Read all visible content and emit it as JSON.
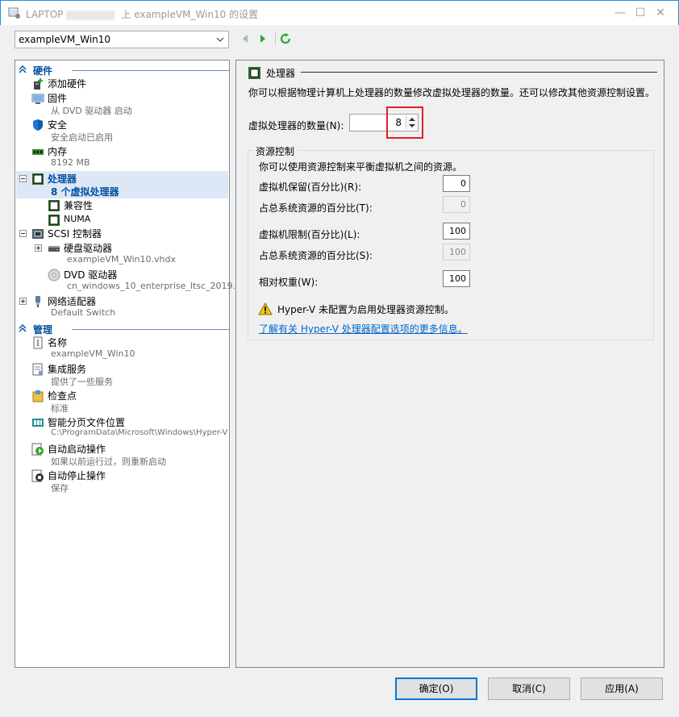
{
  "window": {
    "title_prefix": "LAPTOP",
    "title_suffix": "上 exampleVM_Win10 的设置",
    "minimize": "—",
    "maximize": "☐",
    "close": "✕"
  },
  "vm_selector": {
    "value": "exampleVM_Win10"
  },
  "tree": {
    "hardware_label": "硬件",
    "management_label": "管理",
    "items": {
      "add_hardware": {
        "title": "添加硬件"
      },
      "firmware": {
        "title": "固件",
        "subtitle": "从 DVD 驱动器 启动"
      },
      "security": {
        "title": "安全",
        "subtitle": "安全启动已启用"
      },
      "memory": {
        "title": "内存",
        "subtitle": "8192 MB"
      },
      "processor": {
        "title": "处理器",
        "subtitle": "8 个虚拟处理器"
      },
      "compatibility": {
        "title": "兼容性"
      },
      "numa": {
        "title": "NUMA"
      },
      "scsi": {
        "title": "SCSI 控制器"
      },
      "hard_drive": {
        "title": "硬盘驱动器",
        "subtitle": "exampleVM_Win10.vhdx"
      },
      "dvd_drive": {
        "title": "DVD 驱动器",
        "subtitle": "cn_windows_10_enterprise_ltsc_2019..."
      },
      "network": {
        "title": "网络适配器",
        "subtitle": "Default Switch"
      },
      "name": {
        "title": "名称",
        "subtitle": "exampleVM_Win10"
      },
      "integration": {
        "title": "集成服务",
        "subtitle": "提供了一些服务"
      },
      "checkpoints": {
        "title": "检查点",
        "subtitle": "标准"
      },
      "paging": {
        "title": "智能分页文件位置",
        "subtitle": "C:\\ProgramData\\Microsoft\\Windows\\Hyper-V"
      },
      "auto_start": {
        "title": "自动启动操作",
        "subtitle": "如果以前运行过，则重新启动"
      },
      "auto_stop": {
        "title": "自动停止操作",
        "subtitle": "保存"
      }
    }
  },
  "panel": {
    "title": "处理器",
    "description": "你可以根据物理计算机上处理器的数量修改虚拟处理器的数量。还可以修改其他资源控制设置。",
    "count_label": "虚拟处理器的数量(N):",
    "count_value": "8",
    "resource_control": {
      "title": "资源控制",
      "description": "你可以使用资源控制来平衡虚拟机之间的资源。",
      "reserve_label": "虚拟机保留(百分比)(R):",
      "reserve_value": "0",
      "reserve_total_label": "占总系统资源的百分比(T):",
      "reserve_total_value": "0",
      "limit_label": "虚拟机限制(百分比)(L):",
      "limit_value": "100",
      "limit_total_label": "占总系统资源的百分比(S):",
      "limit_total_value": "100",
      "weight_label": "相对权重(W):",
      "weight_value": "100",
      "warning": "Hyper-V 未配置为启用处理器资源控制。",
      "link": "了解有关 Hyper-V 处理器配置选项的更多信息。"
    }
  },
  "buttons": {
    "ok": "确定(O)",
    "cancel": "取消(C)",
    "apply": "应用(A)"
  },
  "colors": {
    "section_heading": "#0050a0",
    "selection": "#dde8f6",
    "highlight_box": "#e01f2a",
    "link": "#0066cc",
    "title_bar_border": "#1e90d6"
  }
}
